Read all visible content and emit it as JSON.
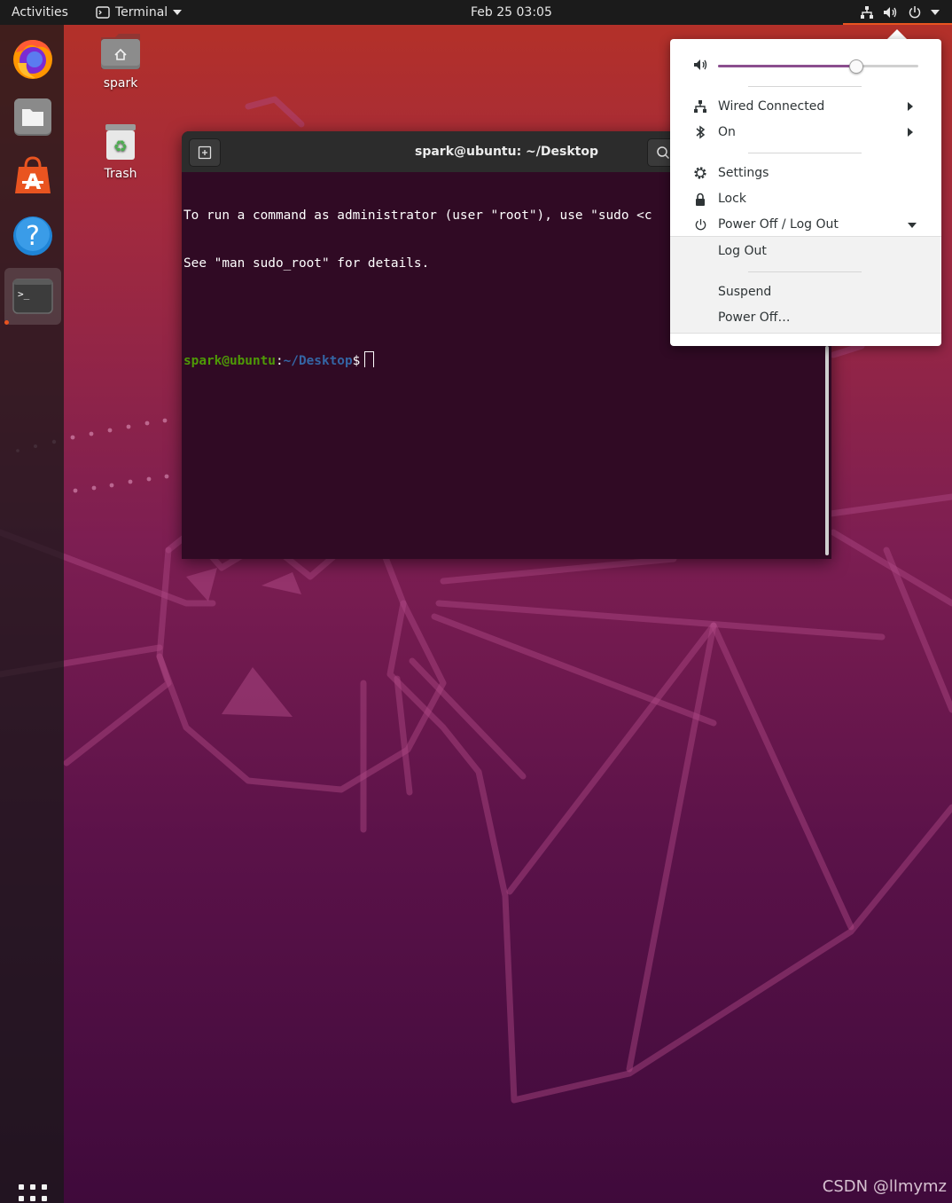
{
  "topbar": {
    "activities": "Activities",
    "app_name": "Terminal",
    "clock": "Feb 25  03:05"
  },
  "dock": {
    "apps": [
      {
        "name": "firefox-icon"
      },
      {
        "name": "files-icon"
      },
      {
        "name": "software-icon"
      },
      {
        "name": "help-icon"
      },
      {
        "name": "terminal-icon",
        "running": true
      }
    ]
  },
  "desktop": {
    "icons": [
      {
        "label": "spark"
      },
      {
        "label": "Trash"
      }
    ]
  },
  "terminal": {
    "title": "spark@ubuntu: ~/Desktop",
    "lines": [
      "To run a command as administrator (user \"root\"), use \"sudo <c",
      "See \"man sudo_root\" for details."
    ],
    "prompt_user": "spark@ubuntu",
    "prompt_sep": ":",
    "prompt_path": "~/Desktop",
    "prompt_symbol": "$"
  },
  "tray_menu": {
    "volume_level": 0.69,
    "wired": "Wired Connected",
    "bluetooth": "On",
    "settings": "Settings",
    "lock": "Lock",
    "power_off_log_out": "Power Off / Log Out",
    "log_out": "Log Out",
    "suspend": "Suspend",
    "power_off": "Power Off…"
  },
  "watermark": "CSDN @llmymz",
  "colors": {
    "accent": "#e95420",
    "terminal_bg": "#300a24",
    "prompt_user": "#4e9a06",
    "prompt_path": "#3465a4",
    "slider_fill": "#8b4e8e"
  }
}
